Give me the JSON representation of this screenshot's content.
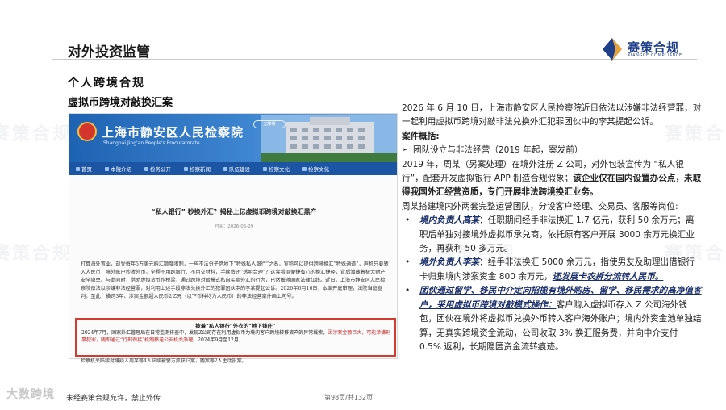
{
  "header": {
    "title": "对外投资监管",
    "logo_text": "赛策合规",
    "logo_sub": "XIANGCE COMPLIANCE"
  },
  "section_title": "个人跨境合规",
  "case_title": "虚拟币跨境对敲换汇案",
  "screenshot": {
    "site_title": "上海市静安区人民检察院",
    "site_subtitle": "Shanghai Jing'an People's Procuratorate",
    "search_label": "无障碍",
    "nav": [
      "首页",
      "本院介绍",
      "检务公开",
      "检察新闻",
      "队伍建设",
      "检察文化",
      "检察文化"
    ],
    "article_title": "“私人银行” 秒换外汇？揭秘上亿虚拟币跨境对敲换汇黑产",
    "article_date": "时间：2026-06-29",
    "body": "打算海外置业，却受每年5万美元购汇额度限制，一些不法分子借地下“特殊私人银行”之名，宣称可以提供跨境换汇“特殊通道”，声称只要转入人民币，境外账户秒收外币，全程不用跑银行、不用交材料，手续费还“透明合理”？这套看似便捷省心的换汇捷径，背后潜藏着极大财产安全隐患。与此同时，借助虚拟货币作桥梁，通过跨境对敲模式私自买卖外汇的行为，已然触碰国家法律红线。近日，上海市静安区人民检察院依法以涉嫌非法经营罪，对利用上述手段非法兑换外汇的犯罪团伙中的李某提起公诉。2026年6月10日，本案开庭审理，法院当庭宣判。至此，横跨3年、涉案金额超人民币2亿元（以下币种均为人民币）的非法经营案件画上句号。",
    "highlight_title": "披着“私人银行”外衣的“地下钱庄”",
    "highlight_text_1": "2024年7月，国家外汇管理局在日常监测排查中，发现Z公司存在利用虚拟币为境内客户跨境转移资产的异常线索，",
    "highlight_text_red": "因涉案金额巨大，可能涉嫌刑事犯罪，随即通过“行刑衔接”机制移送公安机关办理。",
    "highlight_text_2": "2024年9月至12月，",
    "highlight_tail": "检察机关陆续对嫌疑人周某等4人陆续被警方抓获归案，随案等2人主动投案。"
  },
  "right": {
    "intro": "2026 年 6 月 10 日，上海市静安区人民检察院近日依法以涉嫌非法经营罪，对一起利用虚拟币跨境对敲非法兑换外汇犯罪团伙中的李某提起公诉。",
    "case_label": "案件概括:",
    "b1": "团队设立与非法经营（2019 年起，案发前）",
    "p1_a": "2019 年，周某（另案处理）在境外注册 Z 公司，对外包装宣传为 “私人银行”，配套开发虚拟银行 APP 制造合规假象；",
    "p1_b": "该企业仅在国内设置办公点，未取得我国外汇经营资质，专门开展非法跨境换汇业务。",
    "p2": "周某搭建境内外两套完整运营团队，分设客户经理、交易员、客服等岗位:",
    "s1_lead": "境内负责人高某",
    "s1_text": "：任职期间经手非法换汇 1.7 亿元，获利 50 余万元；离职后单独对接境外虚拟币承兑商，依托原有客户开展 3000 余万元换汇业务，再获利 50 多万元。",
    "s2_lead": "境外负责人李某",
    "s2_text": "：经手非法换汇 5000 余万元，指使男友及助理出借银行卡归集境内涉案资金 800 余万元，",
    "s2_tail": "还发展卡农拆分流转人民币。",
    "s3_lead": "团伙通过留学、移民中介定向招揽有境外购房、留学、移民需求的高净值客户，采用虚拟币跨境对敲模式操作：",
    "s3_text": "客户购入虚拟币存入 Z 公司海外钱包，团伙在境外将虚拟币兑换外币转入客户海外账户；境内外资金池单独结算，无真实跨境资金流动，公司收取 3% 换汇服务费，并向中介支付 0.5% 返利，长期隐匿资金流转痕迹。"
  },
  "footer": {
    "left": "未经赛策合规允许，禁止外传",
    "page": "第98页/共132页",
    "corner_mark": "大数跨境"
  },
  "colors": {
    "brand_blue": "#1f3f8a",
    "banner_blue": "#1e63b3",
    "highlight_red": "#d23b30"
  }
}
